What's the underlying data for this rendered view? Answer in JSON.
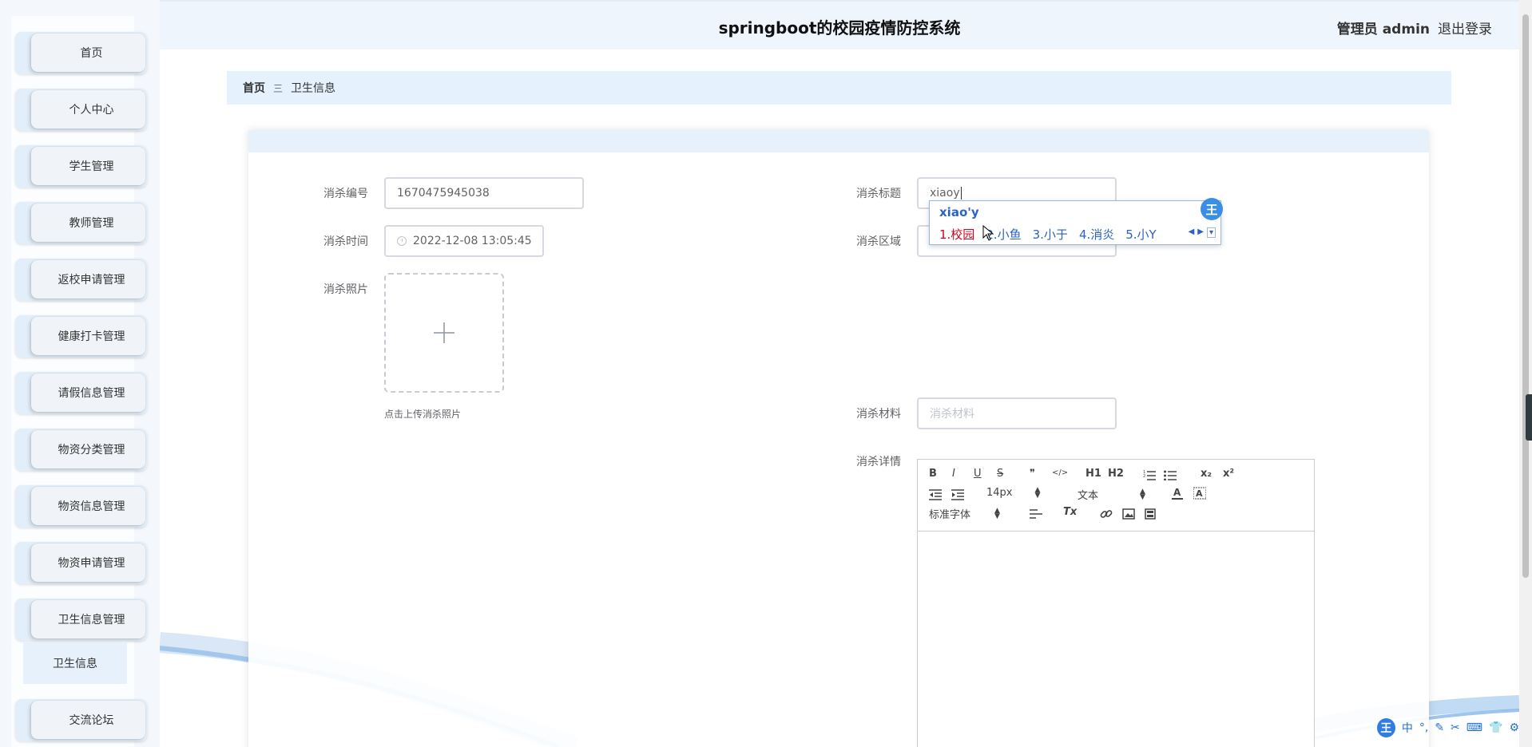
{
  "header": {
    "title": "springboot的校园疫情防控系统",
    "user": "管理员 admin",
    "logout": "退出登录"
  },
  "sidebar": {
    "items": [
      {
        "label": "首页"
      },
      {
        "label": "个人中心"
      },
      {
        "label": "学生管理"
      },
      {
        "label": "教师管理"
      },
      {
        "label": "返校申请管理"
      },
      {
        "label": "健康打卡管理"
      },
      {
        "label": "请假信息管理"
      },
      {
        "label": "物资分类管理"
      },
      {
        "label": "物资信息管理"
      },
      {
        "label": "物资申请管理"
      },
      {
        "label": "卫生信息管理"
      },
      {
        "label": "交流论坛"
      }
    ],
    "submenu": {
      "label": "卫生信息"
    }
  },
  "breadcrumb": {
    "home": "首页",
    "separator": "三",
    "current": "卫生信息"
  },
  "form": {
    "number": {
      "label": "消杀编号",
      "value": "1670475945038"
    },
    "time": {
      "label": "消杀时间",
      "value": "2022-12-08 13:05:45"
    },
    "photo": {
      "label": "消杀照片",
      "hint": "点击上传消杀照片"
    },
    "title": {
      "label": "消杀标题",
      "value": "xiaoy"
    },
    "area": {
      "label": "消杀区域",
      "value": ""
    },
    "material": {
      "label": "消杀材料",
      "placeholder": "消杀材料"
    },
    "details": {
      "label": "消杀详情"
    }
  },
  "editor": {
    "font_size": "14px",
    "text_type": "文本",
    "font_family": "标准字体",
    "buttons": {
      "bold": "B",
      "italic": "I",
      "underline": "U",
      "strike": "S",
      "quote": "❞",
      "code": "</>",
      "h1": "H1",
      "h2": "H2",
      "sub": "x₂",
      "sup": "x²",
      "clear": "Tx"
    }
  },
  "ime": {
    "composition": "xiao'y",
    "candidates": [
      "1.校园",
      "2.小鱼",
      "3.小于",
      "4.消炎",
      "5.小Y"
    ],
    "logo": "王",
    "bar": [
      "中",
      "°,",
      "✎",
      "✂",
      "⌨",
      "👕",
      "⚙"
    ]
  },
  "colors": {
    "accent": "#e5f1fc",
    "header_bg": "#eef5fc",
    "ime_blue": "#2b62c5"
  }
}
